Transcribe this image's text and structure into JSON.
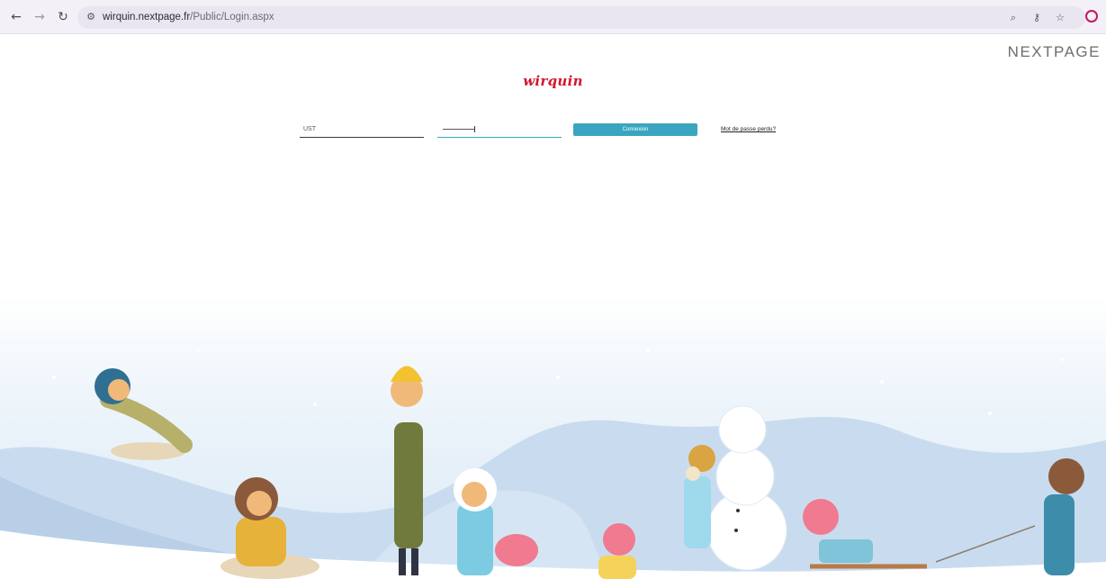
{
  "browser": {
    "url_domain": "wirquin.nextpage.fr",
    "url_path": "/Public/Login.aspx",
    "icons": [
      "back-icon",
      "forward-icon",
      "reload-icon",
      "site-info-icon",
      "zoom-icon",
      "password-key-icon",
      "bookmark-star-icon",
      "profile-icon"
    ]
  },
  "header": {
    "vendor_logo": "NEXTPAGE",
    "brand_logo": "wirquin"
  },
  "login": {
    "username_value": "UST",
    "password_value": "",
    "submit_label": "Connexion",
    "lost_password_label": "Mot de passe perdu?"
  },
  "colors": {
    "accent": "#3aa5c0",
    "brand_red": "#d3162d",
    "chrome_bg": "#f3f0f8"
  },
  "illustration": {
    "description_icon": "winter-children-sledding-illustration"
  }
}
